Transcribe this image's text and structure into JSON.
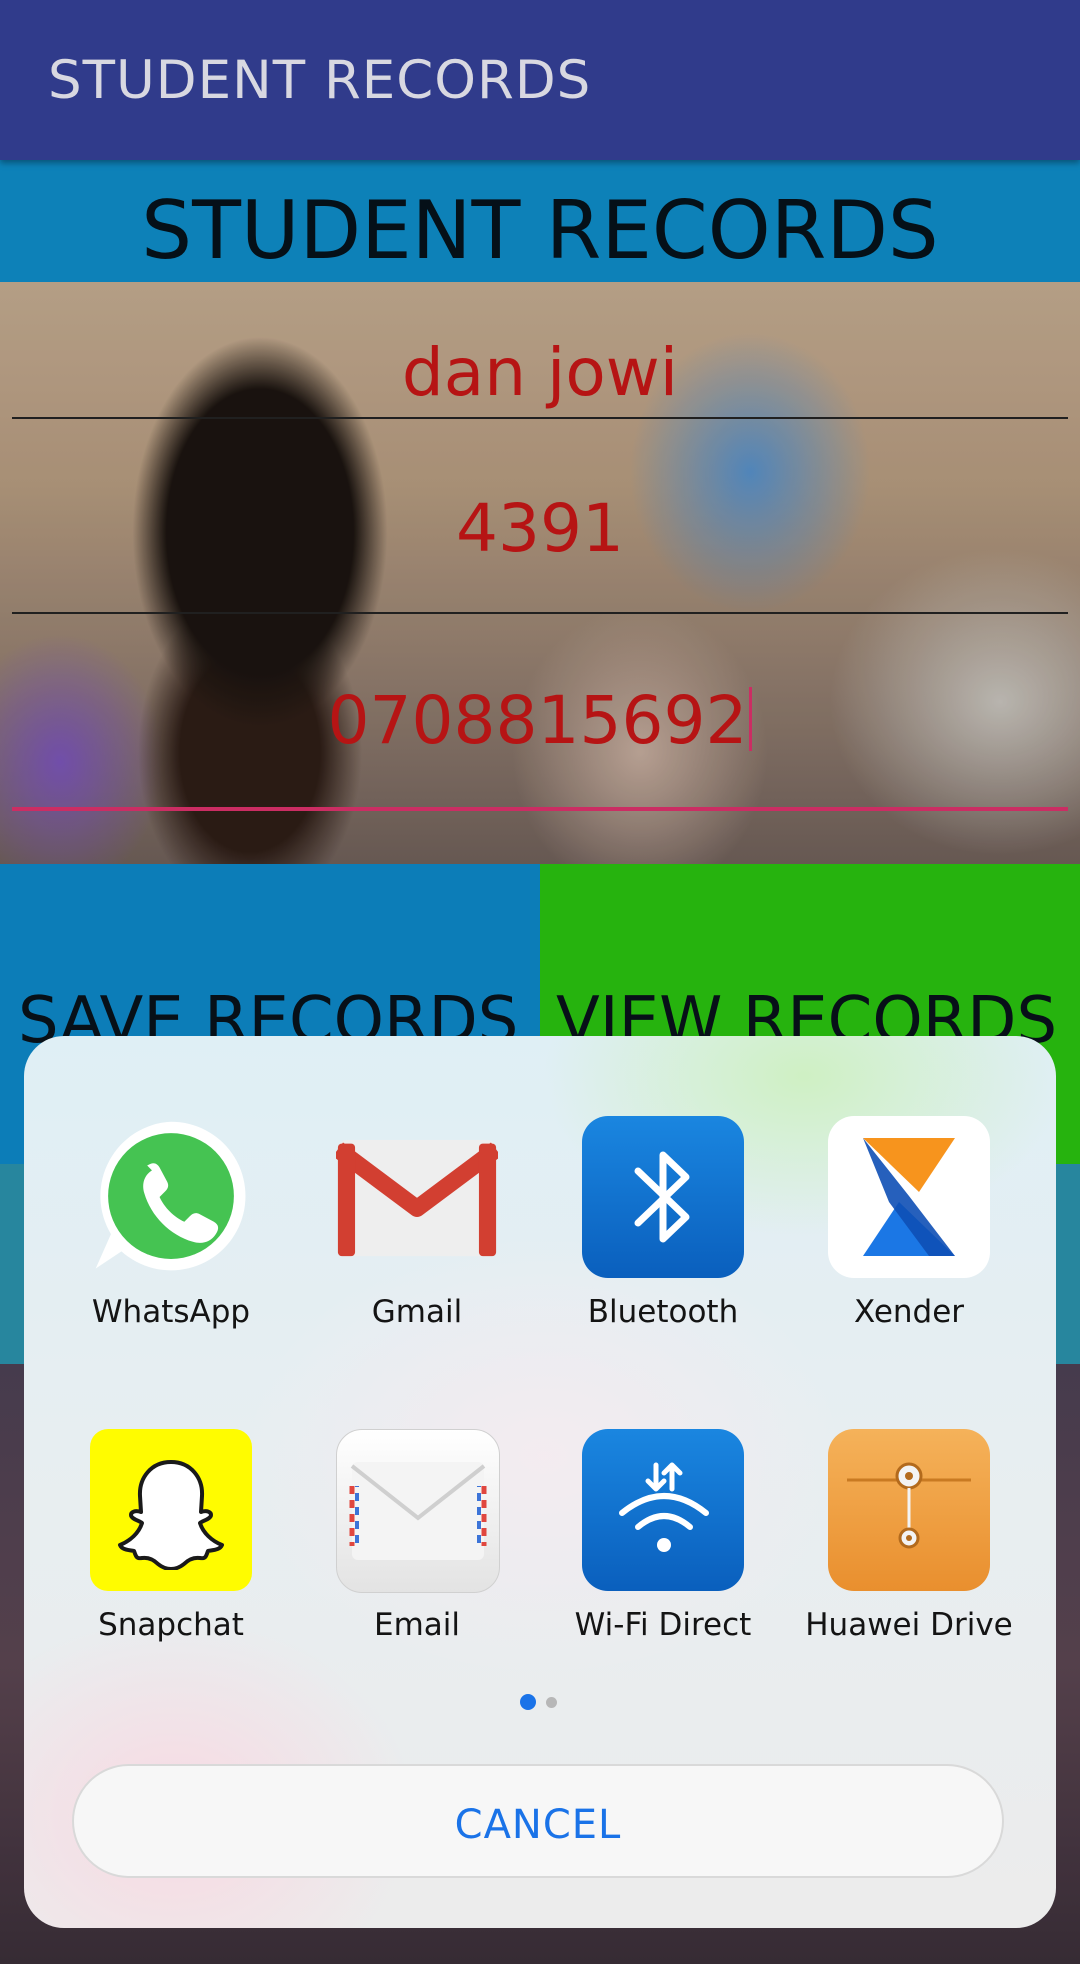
{
  "appbar": {
    "title": "STUDENT RECORDS",
    "color": "#333f94"
  },
  "banner": {
    "title": "STUDENT RECORDS",
    "color": "#0e8ac4"
  },
  "form": {
    "name_value": "dan jowi",
    "id_value": "4391",
    "phone_value": "0708815692"
  },
  "buttons": {
    "save_label": "SAVE RECORDS",
    "view_label": "VIEW RECORDS",
    "save_color": "#0d85c4",
    "view_color": "#29bf0f"
  },
  "share_sheet": {
    "apps": [
      {
        "label": "WhatsApp",
        "icon": "whatsapp-icon"
      },
      {
        "label": "Gmail",
        "icon": "gmail-icon"
      },
      {
        "label": "Bluetooth",
        "icon": "bluetooth-icon"
      },
      {
        "label": "Xender",
        "icon": "xender-icon"
      },
      {
        "label": "Snapchat",
        "icon": "snapchat-icon"
      },
      {
        "label": "Email",
        "icon": "email-icon"
      },
      {
        "label": "Wi-Fi Direct",
        "icon": "wifi-direct-icon"
      },
      {
        "label": "Huawei Drive",
        "icon": "huawei-drive-icon"
      }
    ],
    "page_indicator": {
      "current": 1,
      "total": 2
    },
    "cancel_label": "CANCEL",
    "accent": "#1a73e8"
  }
}
